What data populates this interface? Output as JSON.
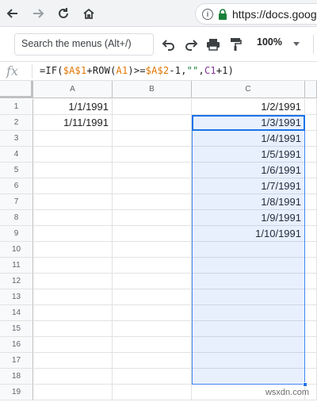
{
  "browser": {
    "url": "https://docs.goog",
    "info_glyph": "i"
  },
  "toolbar": {
    "menu_search_label": "Search the menus (Alt+/)",
    "zoom": "100%"
  },
  "formula_bar": {
    "fx_label": "fx",
    "formula_parts": [
      {
        "text": "=IF(",
        "color": "#202124"
      },
      {
        "text": "$A$1",
        "color": "#e37400"
      },
      {
        "text": "+ROW(",
        "color": "#202124"
      },
      {
        "text": "A1",
        "color": "#e37400"
      },
      {
        "text": ")>=",
        "color": "#202124"
      },
      {
        "text": "$A$2",
        "color": "#e37400"
      },
      {
        "text": "-1,",
        "color": "#202124"
      },
      {
        "text": "\"\"",
        "color": "#188038"
      },
      {
        "text": ",",
        "color": "#202124"
      },
      {
        "text": "C1",
        "color": "#7e3794"
      },
      {
        "text": "+1)",
        "color": "#202124"
      }
    ]
  },
  "sheet": {
    "columns": [
      "A",
      "B",
      "C"
    ],
    "rows": [
      "1",
      "2",
      "3",
      "4",
      "5",
      "6",
      "7",
      "8",
      "9",
      "10",
      "11",
      "12",
      "13",
      "14",
      "15",
      "16",
      "17",
      "18",
      "19"
    ],
    "column_a": [
      "1/1/1991",
      "1/11/1991"
    ],
    "column_c": [
      "1/2/1991",
      "1/3/1991",
      "1/4/1991",
      "1/5/1991",
      "1/6/1991",
      "1/7/1991",
      "1/8/1991",
      "1/9/1991",
      "1/10/1991"
    ]
  },
  "colors": {
    "selection_border": "#4285f4",
    "active_cell_border": "#1a73e8",
    "lock_green": "#188038"
  },
  "watermark": "wsxdn.com"
}
